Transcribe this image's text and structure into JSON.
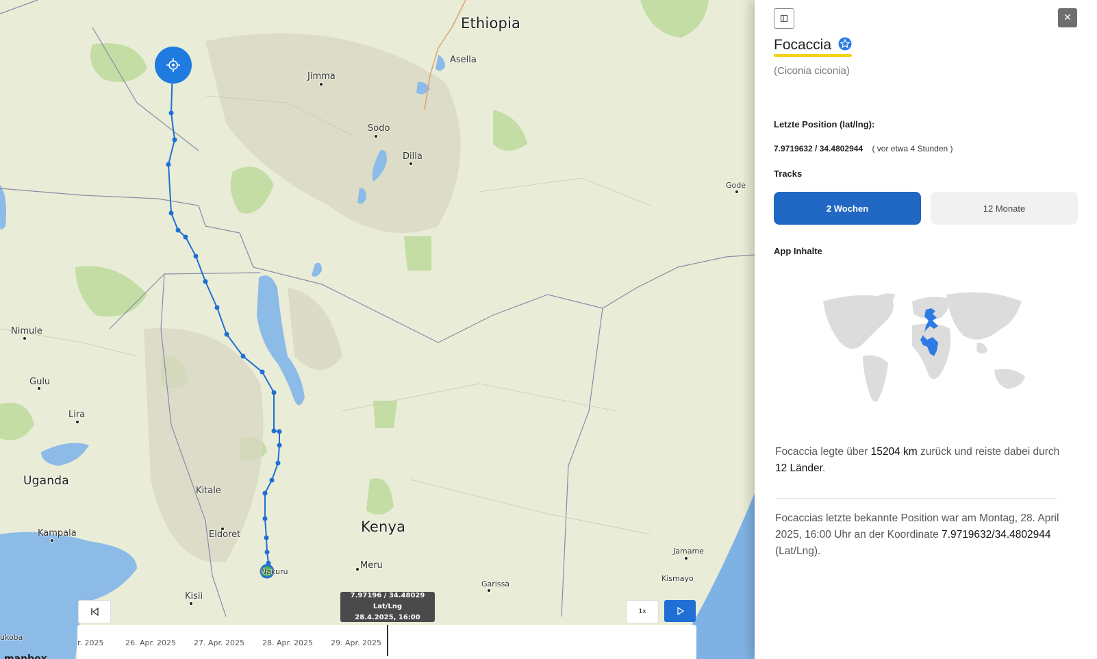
{
  "map": {
    "countries": [
      {
        "name": "Ethiopia"
      },
      {
        "name": "Uganda"
      },
      {
        "name": "Kenya"
      }
    ],
    "cities": [
      {
        "name": "Jimma"
      },
      {
        "name": "Asella"
      },
      {
        "name": "Sodo"
      },
      {
        "name": "Dilla"
      },
      {
        "name": "Gode"
      },
      {
        "name": "Nimule"
      },
      {
        "name": "Gulu"
      },
      {
        "name": "Lira"
      },
      {
        "name": "Kitale"
      },
      {
        "name": "Eldoret"
      },
      {
        "name": "Kampala"
      },
      {
        "name": "Kisii"
      },
      {
        "name": "Meru"
      },
      {
        "name": "Garissa"
      },
      {
        "name": "Jamame"
      },
      {
        "name": "Kismayo"
      },
      {
        "name": "Nakuru"
      },
      {
        "name": "ukoba"
      }
    ],
    "track_color": "#1f6fd4",
    "attribution": "mapbox",
    "location_icon": "crosshair-icon"
  },
  "player": {
    "tooltip_coords": "7.97196 / 34.48029 Lat/Lng",
    "tooltip_time": "28.4.2025, 16:00",
    "speed": "1x",
    "timeline_ticks": [
      "r. 2025",
      "26. Apr. 2025",
      "27. Apr. 2025",
      "28. Apr. 2025",
      "29. Apr. 2025"
    ]
  },
  "panel": {
    "name": "Focaccia",
    "species": "(Ciconia ciconia)",
    "last_position_label": "Letzte Position (lat/lng):",
    "last_position_value": "7.9719632 / 34.4802944",
    "last_position_relative": "( vor etwa 4 Stunden )",
    "tracks_label": "Tracks",
    "tabs": [
      {
        "label": "2 Wochen",
        "active": true
      },
      {
        "label": "12 Monate",
        "active": false
      }
    ],
    "app_content_label": "App Inhalte",
    "summary": {
      "p1_a": "Focaccia legte über ",
      "distance": "15204 km",
      "p1_b": " zurück und reiste dabei durch ",
      "countries": "12 Länder",
      "p1_c": ".",
      "p2_a": "Focaccias letzte bekannte Position war am Montag, 28. April 2025, 16:00 Uhr an der Koordinate ",
      "coordinate": "7.9719632/34.4802944",
      "p2_b": " (Lat/Lng)."
    },
    "accent": "#2167c4",
    "highlight": "#f2d21a"
  }
}
